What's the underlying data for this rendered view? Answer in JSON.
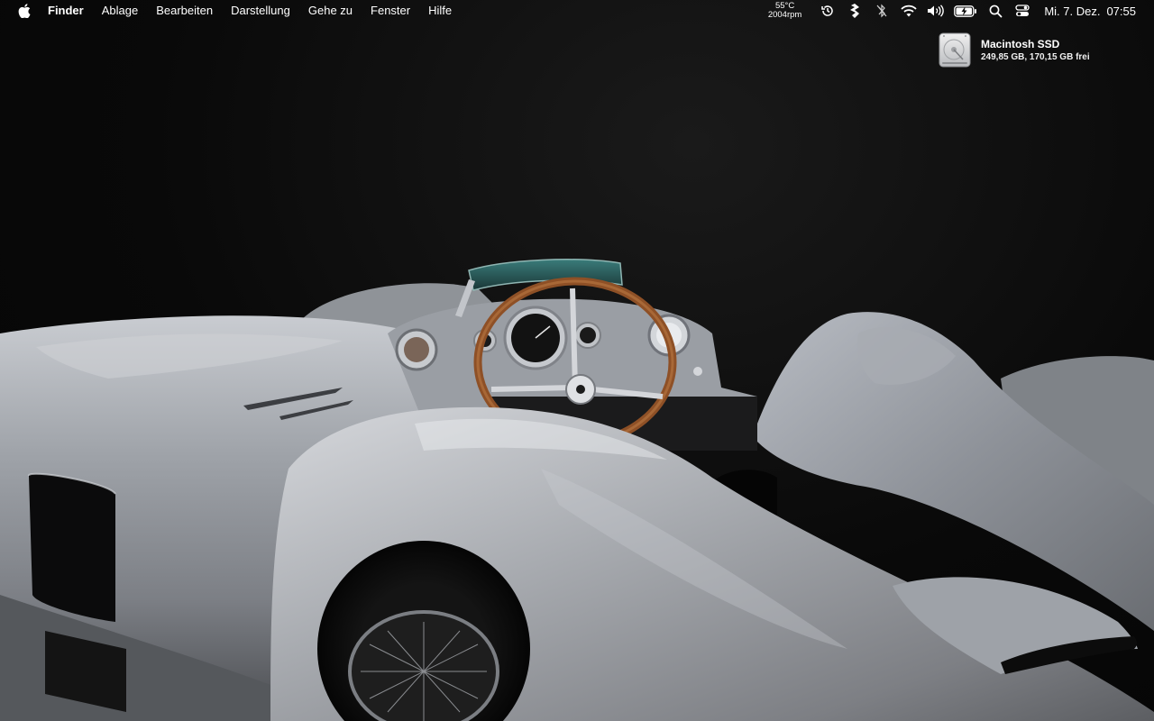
{
  "menubar": {
    "apple_icon": "apple-logo",
    "app_name": "Finder",
    "menus": [
      "Ablage",
      "Bearbeiten",
      "Darstellung",
      "Gehe zu",
      "Fenster",
      "Hilfe"
    ]
  },
  "status": {
    "sensor": {
      "temperature": "55°C",
      "fan_speed": "2004rpm"
    },
    "icons": [
      "time-machine-icon",
      "script-icon",
      "bluetooth-off-icon",
      "wifi-icon",
      "volume-icon",
      "battery-charging-icon",
      "spotlight-search-icon",
      "control-center-icon"
    ],
    "clock": {
      "date": "Mi. 7. Dez.",
      "time": "07:55"
    }
  },
  "desktop": {
    "disk": {
      "name": "Macintosh SSD",
      "info": "249,85 GB, 170,15 GB frei",
      "icon": "hard-drive-icon"
    },
    "wallpaper": "silver vintage race car on black background"
  },
  "colors": {
    "menubar_text": "#ffffff",
    "background": "#080808",
    "car_silver": "#a9acb1",
    "steering_wood": "#9a5a2c"
  }
}
